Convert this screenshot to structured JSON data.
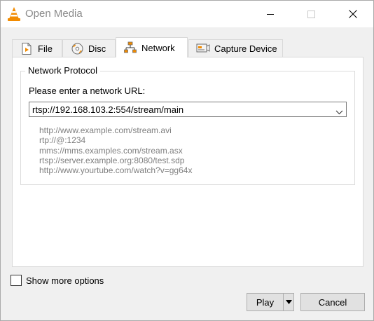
{
  "window": {
    "title": "Open Media",
    "controls": {
      "minimize": "minimize-icon",
      "maximize": "maximize-icon",
      "close": "close-icon"
    }
  },
  "tabs": [
    {
      "label": "File",
      "icon": "file-icon",
      "active": false
    },
    {
      "label": "Disc",
      "icon": "disc-icon",
      "active": false
    },
    {
      "label": "Network",
      "icon": "network-icon",
      "active": true
    },
    {
      "label": "Capture Device",
      "icon": "capture-device-icon",
      "active": false
    }
  ],
  "network": {
    "group_title": "Network Protocol",
    "prompt": "Please enter a network URL:",
    "url_value": "rtsp://192.168.103.2:554/stream/main",
    "examples": [
      "http://www.example.com/stream.avi",
      "rtp://@:1234",
      "mms://mms.examples.com/stream.asx",
      "rtsp://server.example.org:8080/test.sdp",
      "http://www.yourtube.com/watch?v=gg64x"
    ]
  },
  "options": {
    "show_more_label": "Show more options",
    "show_more_checked": false
  },
  "buttons": {
    "play": "Play",
    "cancel": "Cancel"
  },
  "colors": {
    "vlc_orange": "#f28b00",
    "hint_gray": "#7f7f7f"
  }
}
